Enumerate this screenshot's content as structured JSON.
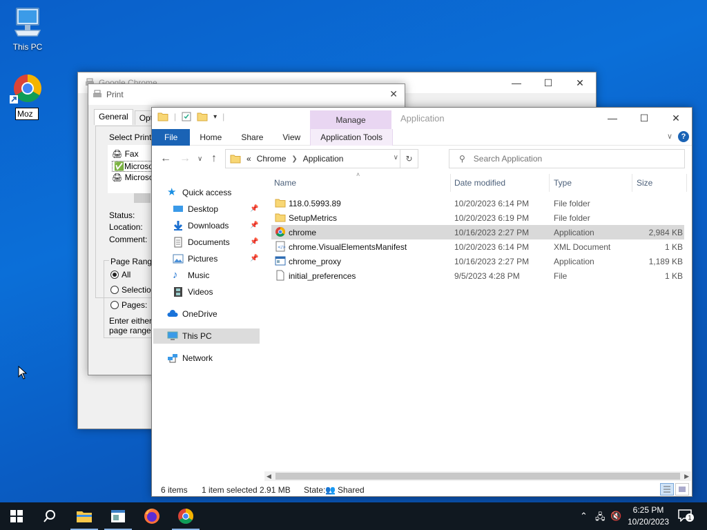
{
  "desktop": {
    "icons": [
      {
        "label": "This PC",
        "icon": "this-pc-icon"
      },
      {
        "label": "Moz",
        "icon": "chrome-icon"
      }
    ]
  },
  "chrome_window": {
    "title": "Google Chrome"
  },
  "print_dialog": {
    "title": "Print",
    "tabs": [
      "General",
      "Option"
    ],
    "select_printer_label": "Select Printe",
    "printers": [
      "Fax",
      "Microso",
      "Microso"
    ],
    "status_label": "Status:",
    "location_label": "Location:",
    "comment_label": "Comment:",
    "page_range_label": "Page Range",
    "range_options": [
      "All",
      "Selection",
      "Pages:"
    ],
    "hint_line1": "Enter either a",
    "hint_line2": "page range."
  },
  "explorer": {
    "title": "Application",
    "manage_tab": "Manage",
    "ribbon_tabs": [
      "File",
      "Home",
      "Share",
      "View",
      "Application Tools"
    ],
    "address": {
      "prefix": "«",
      "crumbs": [
        "Chrome",
        "Application"
      ]
    },
    "search_placeholder": "Search Application",
    "nav": {
      "quick_access": "Quick access",
      "desktop": "Desktop",
      "downloads": "Downloads",
      "documents": "Documents",
      "pictures": "Pictures",
      "music": "Music",
      "videos": "Videos",
      "onedrive": "OneDrive",
      "this_pc": "This PC",
      "network": "Network"
    },
    "columns": {
      "name": "Name",
      "date": "Date modified",
      "type": "Type",
      "size": "Size"
    },
    "files": [
      {
        "name": "118.0.5993.89",
        "date": "10/20/2023 6:14 PM",
        "type": "File folder",
        "size": "",
        "icon": "folder-icon"
      },
      {
        "name": "SetupMetrics",
        "date": "10/20/2023 6:19 PM",
        "type": "File folder",
        "size": "",
        "icon": "folder-icon"
      },
      {
        "name": "chrome",
        "date": "10/16/2023 2:27 PM",
        "type": "Application",
        "size": "2,984 KB",
        "icon": "chrome-icon"
      },
      {
        "name": "chrome.VisualElementsManifest",
        "date": "10/20/2023 6:14 PM",
        "type": "XML Document",
        "size": "1 KB",
        "icon": "xml-file-icon"
      },
      {
        "name": "chrome_proxy",
        "date": "10/16/2023 2:27 PM",
        "type": "Application",
        "size": "1,189 KB",
        "icon": "app-window-icon"
      },
      {
        "name": "initial_preferences",
        "date": "9/5/2023 4:28 PM",
        "type": "File",
        "size": "1 KB",
        "icon": "file-icon"
      }
    ],
    "selected_row": "chrome",
    "status": {
      "items": "6 items",
      "selection": "1 item selected  2.91 MB",
      "state_label": "State:",
      "state_value": "Shared"
    }
  },
  "taskbar": {
    "time": "6:25 PM",
    "date": "10/20/2023",
    "notification_count": "1"
  }
}
